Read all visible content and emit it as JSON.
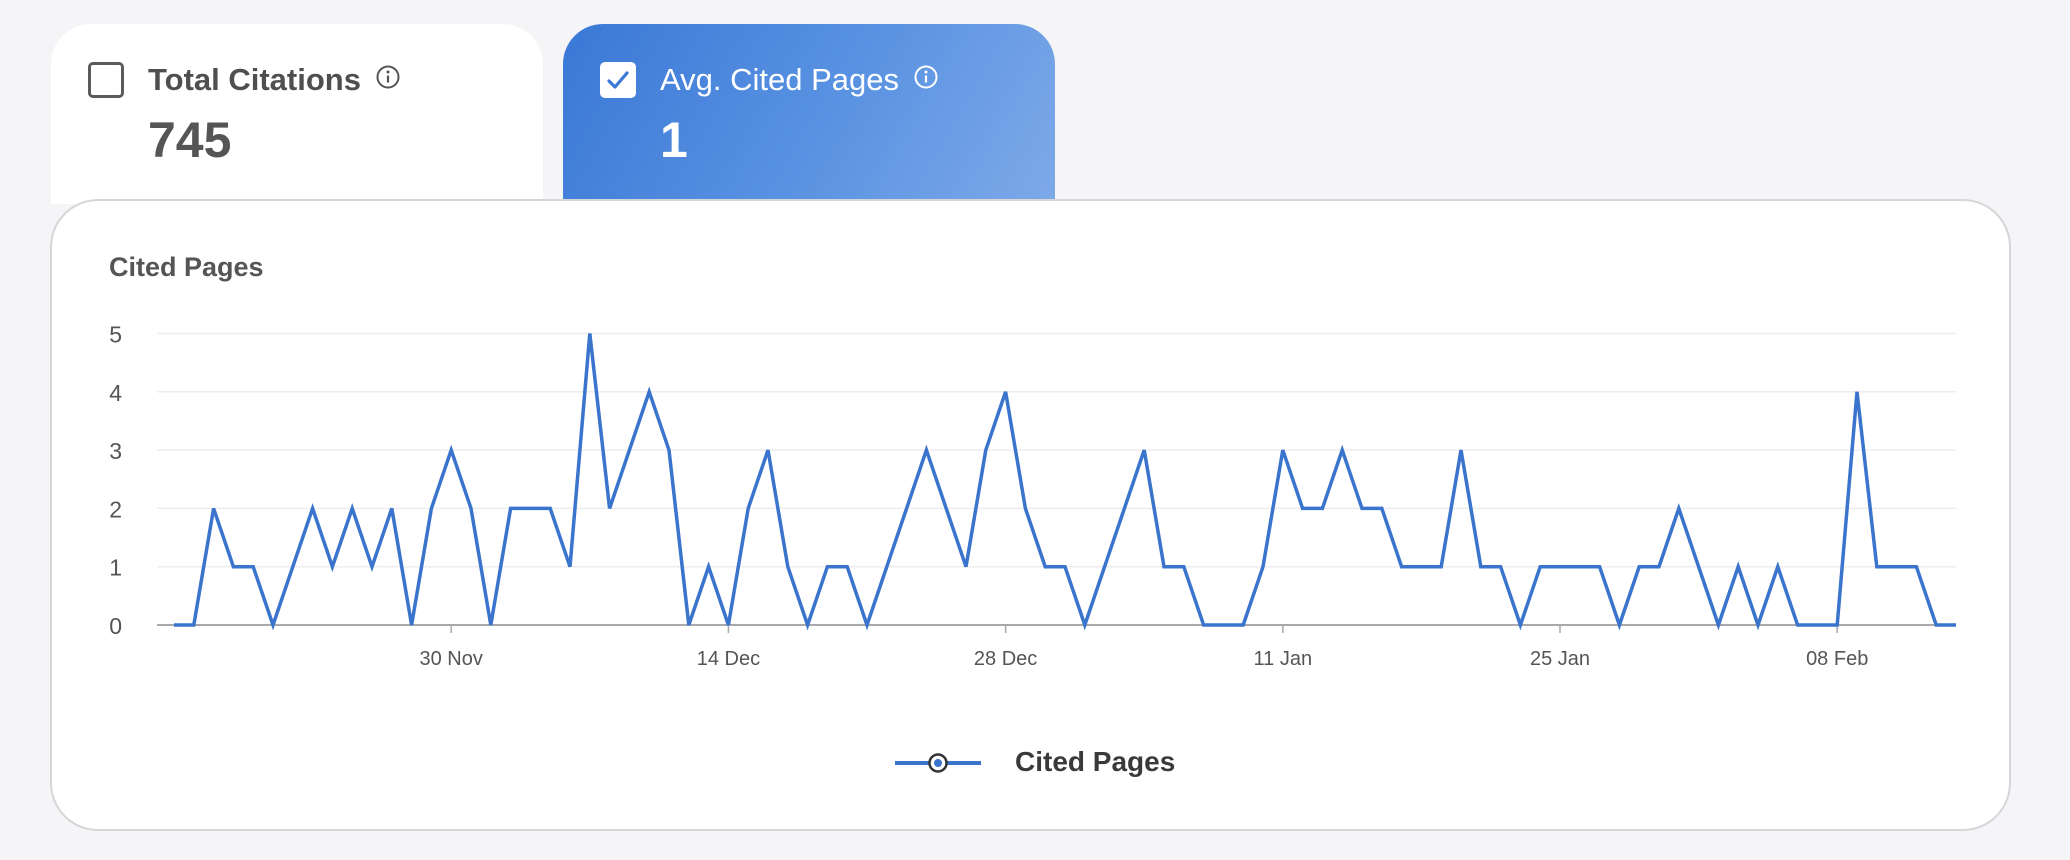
{
  "tabs": [
    {
      "label": "Total Citations",
      "value": "745",
      "checked": false
    },
    {
      "label": "Avg. Cited Pages",
      "value": "1",
      "checked": true
    }
  ],
  "colors": {
    "accent": "#3a78d6",
    "line": "#3a74cc",
    "background": "#f5f4f7"
  },
  "icons": {
    "info": "info-circle-icon",
    "check": "check-icon"
  },
  "chart_data": {
    "type": "line",
    "title": "Cited Pages",
    "xlabel": "",
    "ylabel": "",
    "ylim": [
      0,
      5
    ],
    "y_ticks": [
      0,
      1,
      2,
      3,
      4,
      5
    ],
    "x_tick_labels": [
      "30 Nov",
      "14 Dec",
      "28 Dec",
      "11 Jan",
      "25 Jan",
      "08 Feb"
    ],
    "x_tick_days": [
      14,
      28,
      42,
      56,
      70,
      84
    ],
    "grid": true,
    "legend_position": "bottom-center",
    "series": [
      {
        "name": "Cited Pages",
        "days": [
          0,
          1,
          2,
          3,
          4,
          5,
          6,
          7,
          8,
          9,
          10,
          11,
          12,
          13,
          14,
          15,
          16,
          17,
          18,
          19,
          20,
          21,
          22,
          23,
          24,
          25,
          26,
          27,
          28,
          29,
          30,
          31,
          32,
          33,
          34,
          35,
          36,
          37,
          38,
          39,
          40,
          41,
          42,
          43,
          44,
          45,
          46,
          47,
          48,
          49,
          50,
          51,
          52,
          53,
          54,
          55,
          56,
          57,
          58,
          59,
          60,
          61,
          62,
          63,
          64,
          65,
          66,
          67,
          68,
          69,
          70,
          71,
          72,
          73,
          74,
          75,
          76,
          77,
          78,
          79,
          80,
          81,
          82,
          83,
          84,
          85,
          86,
          87,
          88,
          89,
          90
        ],
        "values": [
          0,
          0,
          2,
          1,
          1,
          0,
          1,
          2,
          1,
          2,
          1,
          2,
          0,
          2,
          3,
          2,
          0,
          2,
          2,
          2,
          1,
          5,
          2,
          3,
          4,
          3,
          0,
          1,
          0,
          2,
          3,
          1,
          0,
          1,
          1,
          0,
          1,
          2,
          3,
          2,
          1,
          3,
          4,
          2,
          1,
          1,
          0,
          1,
          2,
          3,
          1,
          1,
          0,
          0,
          0,
          1,
          3,
          2,
          2,
          3,
          2,
          2,
          1,
          1,
          1,
          3,
          1,
          1,
          0,
          1,
          1,
          1,
          1,
          0,
          1,
          1,
          2,
          1,
          0,
          1,
          0,
          1,
          0,
          0,
          0,
          4,
          1,
          1,
          1,
          0,
          0
        ]
      }
    ]
  }
}
